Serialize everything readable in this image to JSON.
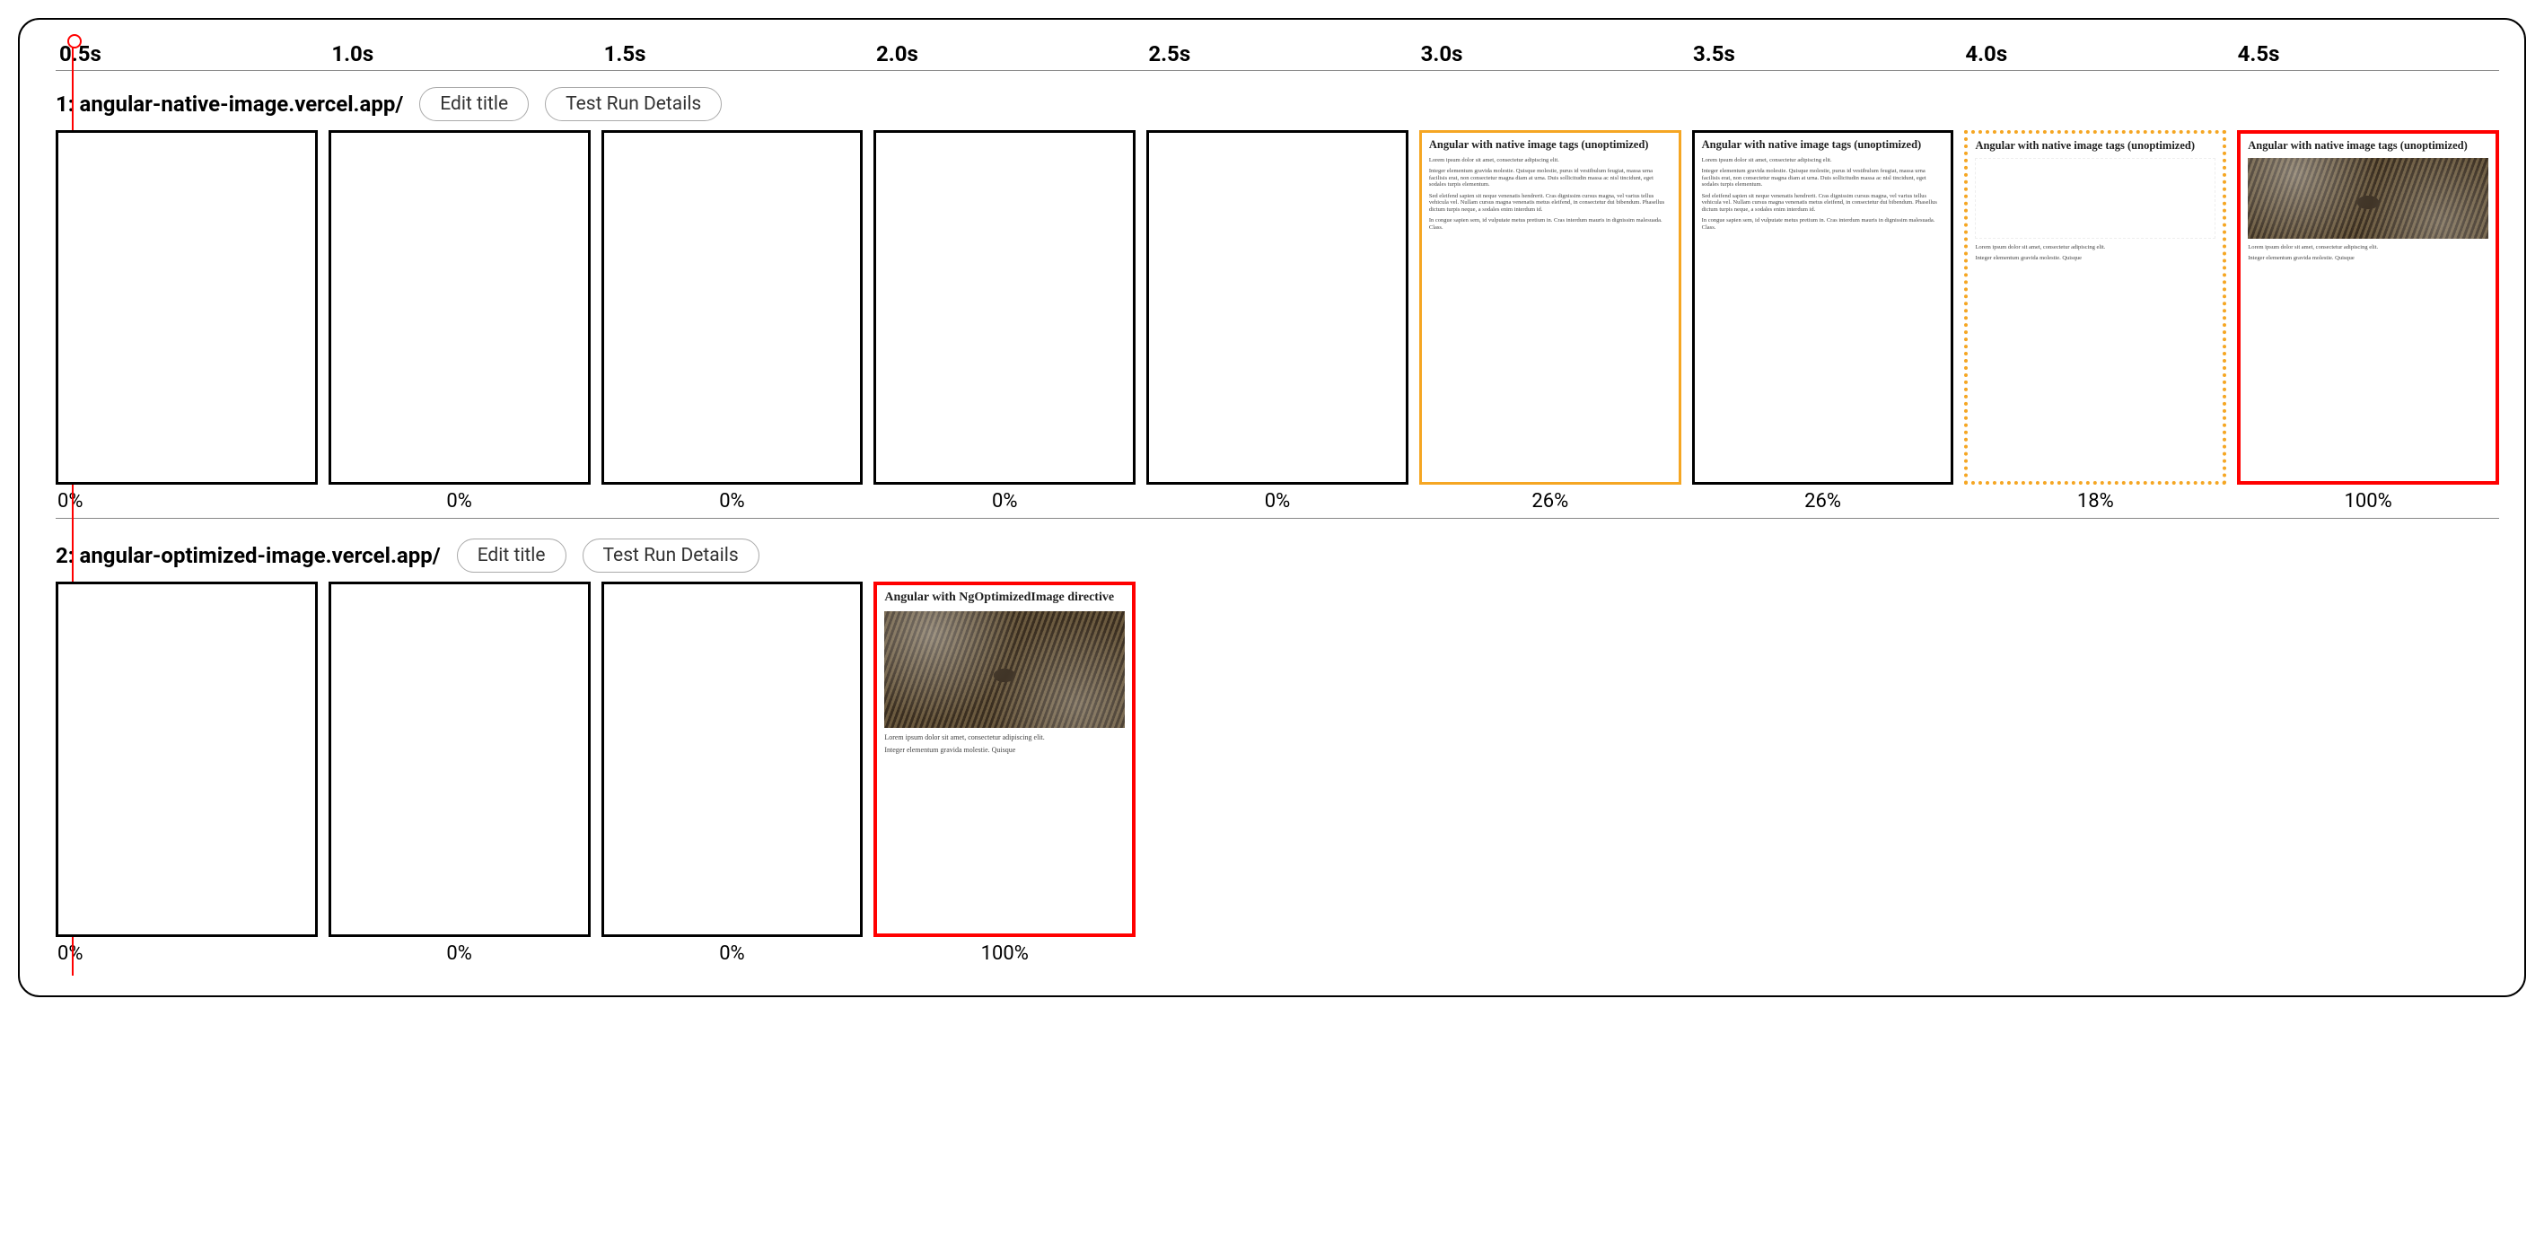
{
  "timeline": {
    "ticks": [
      "0.5s",
      "1.0s",
      "1.5s",
      "2.0s",
      "2.5s",
      "3.0s",
      "3.5s",
      "4.0s",
      "4.5s"
    ]
  },
  "buttons": {
    "edit_title": "Edit title",
    "test_run_details": "Test Run Details"
  },
  "rows": [
    {
      "index_label": "1:",
      "title": "angular-native-image.vercel.app/",
      "percentages": [
        "0%",
        "0%",
        "0%",
        "0%",
        "0%",
        "26%",
        "26%",
        "18%",
        "100%"
      ],
      "frames": [
        {
          "state": "blank",
          "border": "black"
        },
        {
          "state": "blank",
          "border": "black"
        },
        {
          "state": "blank",
          "border": "black"
        },
        {
          "state": "blank",
          "border": "black"
        },
        {
          "state": "blank",
          "border": "black"
        },
        {
          "state": "text",
          "border": "orange-solid",
          "heading": "Angular with native image tags (unoptimized)"
        },
        {
          "state": "text",
          "border": "black",
          "heading": "Angular with native image tags (unoptimized)"
        },
        {
          "state": "text-blank-img",
          "border": "orange-dotted",
          "heading": "Angular with native image tags (unoptimized)"
        },
        {
          "state": "text-img",
          "border": "red",
          "heading": "Angular with native image tags (unoptimized)"
        }
      ]
    },
    {
      "index_label": "2:",
      "title": "angular-optimized-image.vercel.app/",
      "percentages": [
        "0%",
        "0%",
        "0%",
        "100%"
      ],
      "frames": [
        {
          "state": "blank",
          "border": "black"
        },
        {
          "state": "blank",
          "border": "black"
        },
        {
          "state": "blank",
          "border": "black"
        },
        {
          "state": "text-img",
          "border": "red",
          "heading": "Angular with NgOptimizedImage directive"
        }
      ]
    }
  ],
  "lorem": {
    "p1": "Lorem ipsum dolor sit amet, consectetur adipiscing elit.",
    "p2": "Integer elementum gravida molestie. Quisque molestie, purus id vestibulum feugiat, massa urna facilisis erat, non consectetur magna diam at urna. Duis sollicitudin massa ac nisl tincidunt, eget sodales turpis elementum.",
    "p3": "Sed eleifend sapien sit neque venenatis hendrerit. Cras dignissim cursus magna, vel varius tellus vehicula vel. Nullam cursus magna venenatis metus eleifend, in consectetur dui bibendum. Phasellus dictum turpis neque, a sodales enim interdum id.",
    "p4": "In congue sapien sem, id vulputate metus pretium in. Cras interdum mauris in dignissim malesuada. Class.",
    "short1": "Lorem ipsum dolor sit amet, consectetur adipiscing elit.",
    "short2": "Integer elementum gravida molestie. Quisque"
  }
}
